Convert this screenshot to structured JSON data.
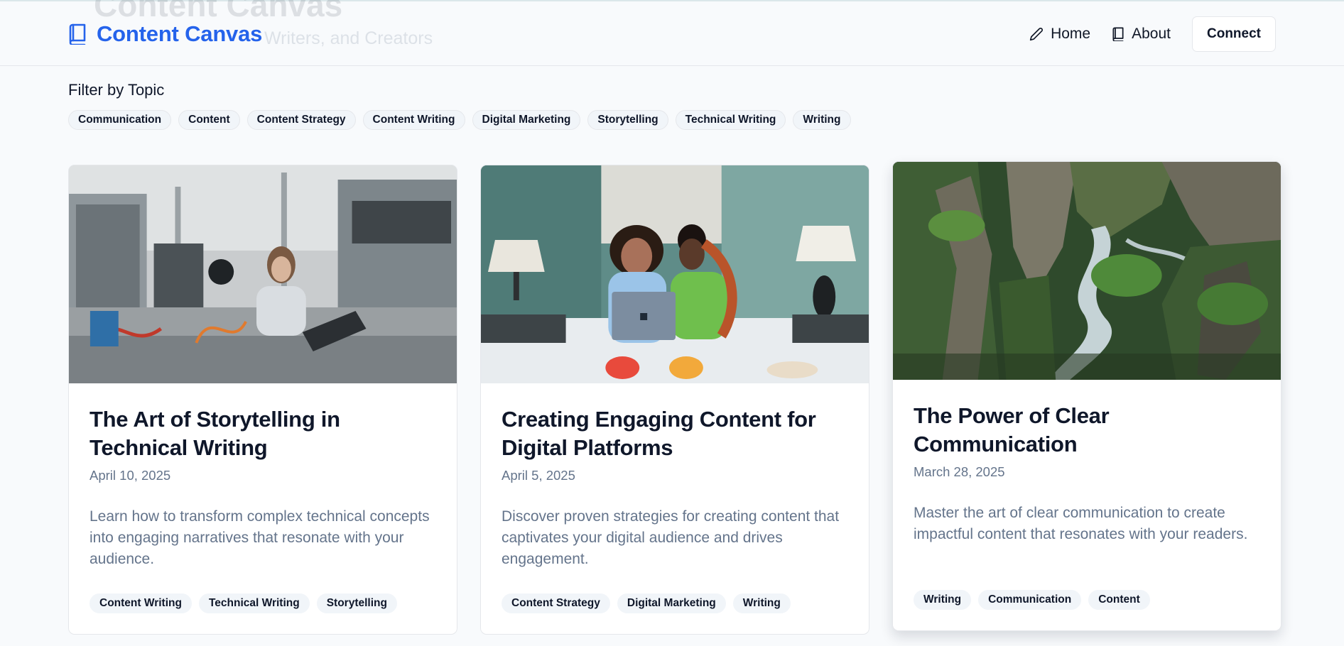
{
  "header": {
    "ghost_title": "Content Canvas",
    "ghost_subtitle": "Writers, and Creators",
    "brand": "Content Canvas",
    "brand_icon": "book-icon",
    "nav": [
      {
        "label": "Home",
        "icon": "pencil-icon"
      },
      {
        "label": "About",
        "icon": "book-icon"
      }
    ],
    "connect_label": "Connect"
  },
  "filter": {
    "heading": "Filter by Topic",
    "topics": [
      "Communication",
      "Content",
      "Content Strategy",
      "Content Writing",
      "Digital Marketing",
      "Storytelling",
      "Technical Writing",
      "Writing"
    ]
  },
  "posts": [
    {
      "title": "The Art of Storytelling in Technical Writing",
      "date": "April 10, 2025",
      "excerpt": "Learn how to transform complex technical concepts into engaging narratives that resonate with your audience.",
      "tags": [
        "Content Writing",
        "Technical Writing",
        "Storytelling"
      ],
      "image": "woman working on laptop in hardware lab"
    },
    {
      "title": "Creating Engaging Content for Digital Platforms",
      "date": "April 5, 2025",
      "excerpt": "Discover proven strategies for creating content that captivates your digital audience and drives engagement.",
      "tags": [
        "Content Strategy",
        "Digital Marketing",
        "Writing"
      ],
      "image": "two women sharing a laptop on a bed"
    },
    {
      "title": "The Power of Clear Communication",
      "date": "March 28, 2025",
      "excerpt": "Master the art of clear communication to create impactful content that resonates with your readers.",
      "tags": [
        "Writing",
        "Communication",
        "Content"
      ],
      "image": "mossy green canyon with river"
    }
  ],
  "colors": {
    "accent": "#2563eb",
    "page_bg": "#f8fafc",
    "muted_text": "#64748b",
    "pill_bg": "#f1f5f9"
  }
}
